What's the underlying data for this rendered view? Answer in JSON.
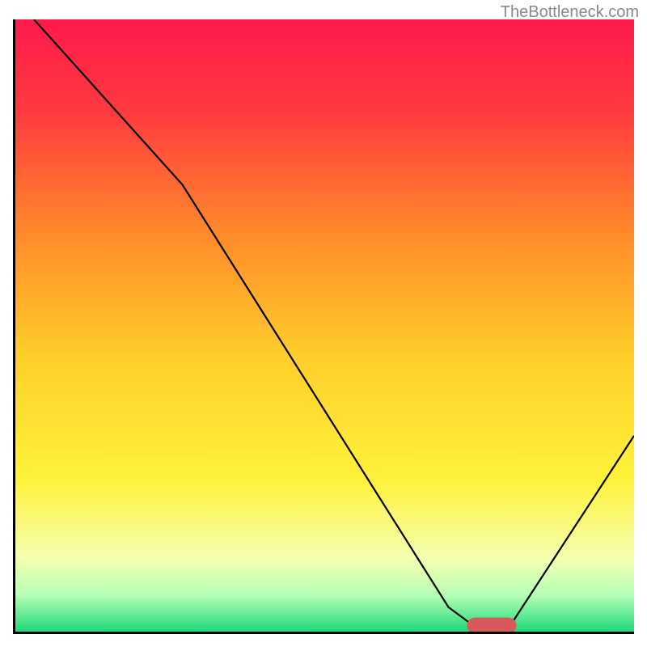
{
  "watermark": "TheBottleneck.com",
  "chart_data": {
    "type": "line",
    "title": "",
    "xlabel": "",
    "ylabel": "",
    "xlim": [
      0,
      100
    ],
    "ylim": [
      0,
      100
    ],
    "background_gradient": {
      "stops": [
        {
          "offset": 0.0,
          "color": "#ff1a4d"
        },
        {
          "offset": 0.15,
          "color": "#ff3a3f"
        },
        {
          "offset": 0.35,
          "color": "#ff8a2a"
        },
        {
          "offset": 0.55,
          "color": "#ffce2a"
        },
        {
          "offset": 0.75,
          "color": "#fff23a"
        },
        {
          "offset": 0.88,
          "color": "#f5ffb0"
        },
        {
          "offset": 0.94,
          "color": "#b6ffb6"
        },
        {
          "offset": 1.0,
          "color": "#1ed97a"
        }
      ]
    },
    "series": [
      {
        "name": "curve",
        "type": "line",
        "color": "#000000",
        "width": 2.2,
        "points": [
          {
            "x": 3.0,
            "y": 100.0
          },
          {
            "x": 27.0,
            "y": 73.0
          },
          {
            "x": 70.0,
            "y": 4.0
          },
          {
            "x": 74.0,
            "y": 1.0
          },
          {
            "x": 80.0,
            "y": 1.0
          },
          {
            "x": 100.0,
            "y": 32.0
          }
        ]
      }
    ],
    "marker": {
      "shape": "rounded-rect",
      "color": "#d65a5a",
      "x_center": 77.0,
      "y_center": 1.0,
      "width": 8.0,
      "height": 2.6,
      "rx_pct": 1.3
    }
  }
}
